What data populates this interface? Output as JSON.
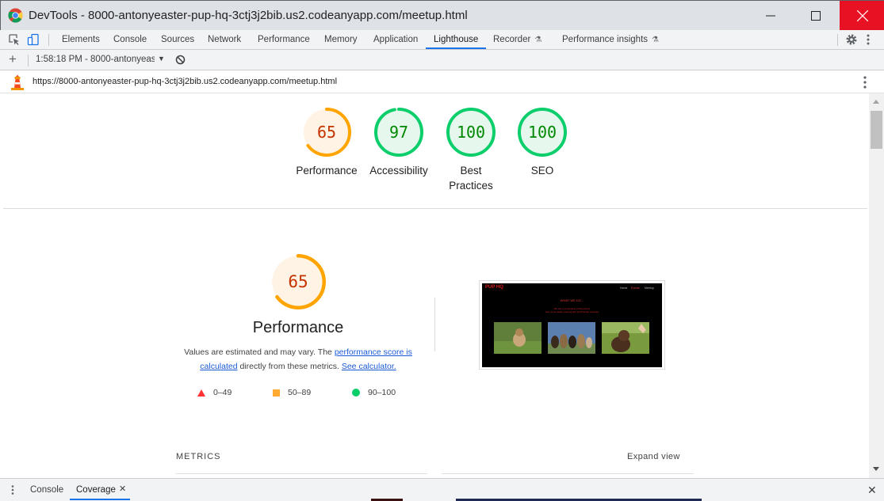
{
  "window": {
    "title": "DevTools - 8000-antonyeaster-pup-hq-3ctj3j2bib.us2.codeanyapp.com/meetup.html"
  },
  "devtools": {
    "tabs": [
      {
        "label": "Elements"
      },
      {
        "label": "Console"
      },
      {
        "label": "Sources"
      },
      {
        "label": "Network"
      },
      {
        "label": "Performance"
      },
      {
        "label": "Memory"
      },
      {
        "label": "Application"
      },
      {
        "label": "Lighthouse",
        "active": true
      },
      {
        "label": "Recorder",
        "experimental": true
      },
      {
        "label": "Performance insights",
        "experimental": true
      }
    ]
  },
  "lighthouse_toolbar": {
    "report_select": "1:58:18 PM - 8000-antonyeast"
  },
  "report": {
    "url": "https://8000-antonyeaster-pup-hq-3ctj3j2bib.us2.codeanyapp.com/meetup.html",
    "scores": [
      {
        "label": "Performance",
        "value": "65",
        "fraction": 0.65,
        "status": "average"
      },
      {
        "label": "Accessibility",
        "value": "97",
        "fraction": 0.97,
        "status": "pass"
      },
      {
        "label": "Best Practices",
        "value": "100",
        "fraction": 1.0,
        "status": "pass"
      },
      {
        "label": "SEO",
        "value": "100",
        "fraction": 1.0,
        "status": "pass"
      }
    ],
    "performance": {
      "score": "65",
      "fraction": 0.65,
      "title": "Performance",
      "desc_prefix": "Values are estimated and may vary. The",
      "desc_link1": "performance score is calculated",
      "desc_middle": "directly from these metrics.",
      "desc_link2": "See calculator."
    },
    "legend": [
      {
        "range": "0–49",
        "shape": "triangle",
        "color": "#ff3333"
      },
      {
        "range": "50–89",
        "shape": "square",
        "color": "#ffaa33"
      },
      {
        "range": "90–100",
        "shape": "circle",
        "color": "#0cce6b"
      }
    ],
    "screenshot": {
      "brand": "PUP HQ",
      "nav": [
        "Home",
        "Events",
        "Meetup"
      ],
      "heading": "WHAT WE DO...",
      "subtext": [
        "We are a community of dog lovers",
        "Join us for walks, training tips and friendly meetups"
      ]
    },
    "metrics_label": "METRICS",
    "expand_view": "Expand view"
  },
  "drawer": {
    "tabs": [
      {
        "label": "Console"
      },
      {
        "label": "Coverage",
        "active": true
      }
    ]
  },
  "colors": {
    "pass": "#0cce6b",
    "pass_text": "#008800",
    "pass_bg": "#e6f8ed",
    "average": "#ffa400",
    "average_text": "#c33300",
    "average_bg": "#fff3e5",
    "accent": "#1a73e8",
    "close_button": "#e81123"
  }
}
